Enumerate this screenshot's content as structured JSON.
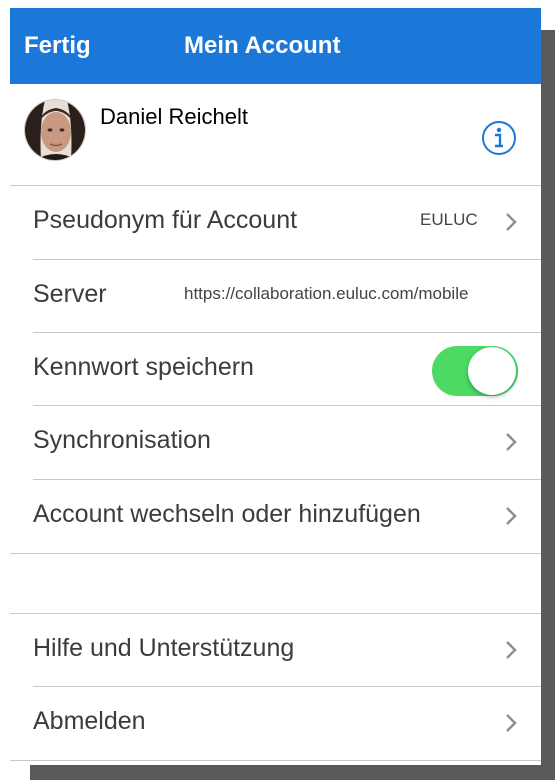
{
  "navbar": {
    "done_label": "Fertig",
    "title": "Mein Account"
  },
  "profile": {
    "name": "Daniel Reichelt",
    "info_icon": "info-circle-icon"
  },
  "rows": {
    "alias": {
      "label": "Pseudonym für Account",
      "value": "EULUC"
    },
    "server": {
      "label": "Server",
      "value": "https://collaboration.euluc.com/mobile"
    },
    "password": {
      "label": "Kennwort speichern",
      "enabled": true
    },
    "sync": {
      "label": "Synchronisation"
    },
    "switch_account": {
      "label": "Account wechseln oder hinzufügen"
    },
    "help": {
      "label": "Hilfe und Unterstützung"
    },
    "logout": {
      "label": "Abmelden"
    }
  },
  "colors": {
    "navbar": "#1b78d9",
    "toggle_on": "#4cd964",
    "info_icon": "#1b78d9",
    "chevron": "#8e8e93"
  }
}
